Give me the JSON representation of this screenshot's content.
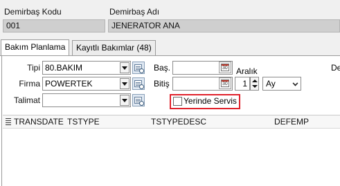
{
  "header": {
    "kod_label": "Demirbaş Kodu",
    "ad_label": "Demirbaş Adı",
    "kod_value": "001",
    "ad_value": "JENERATOR ANA"
  },
  "tabs": [
    {
      "label": "Bakım Planlama",
      "active": true
    },
    {
      "label": "Kayıtlı Bakımlar (48)",
      "active": false
    }
  ],
  "form": {
    "tipi_label": "Tipi",
    "tipi_value": "80.BAKIM",
    "firma_label": "Firma",
    "firma_value": "POWERTEK",
    "talimat_label": "Talimat",
    "talimat_value": "",
    "bas_label": "Baş.",
    "bitis_label": "Bitiş",
    "aralik_label": "Aralık",
    "aralik_value": "1",
    "aralik_unit": "Ay",
    "right_cut_label": "De",
    "yerinde_servis_label": "Yerinde Servis",
    "yerinde_servis_checked": false
  },
  "grid": {
    "columns": [
      "TRANSDATE",
      "TSTYPE",
      "TSTYPEDESC",
      "DEFEMP"
    ]
  },
  "colors": {
    "highlight": "#e0202a",
    "readonly_field": "#cfcfcf",
    "background": "#f0f0f0"
  }
}
